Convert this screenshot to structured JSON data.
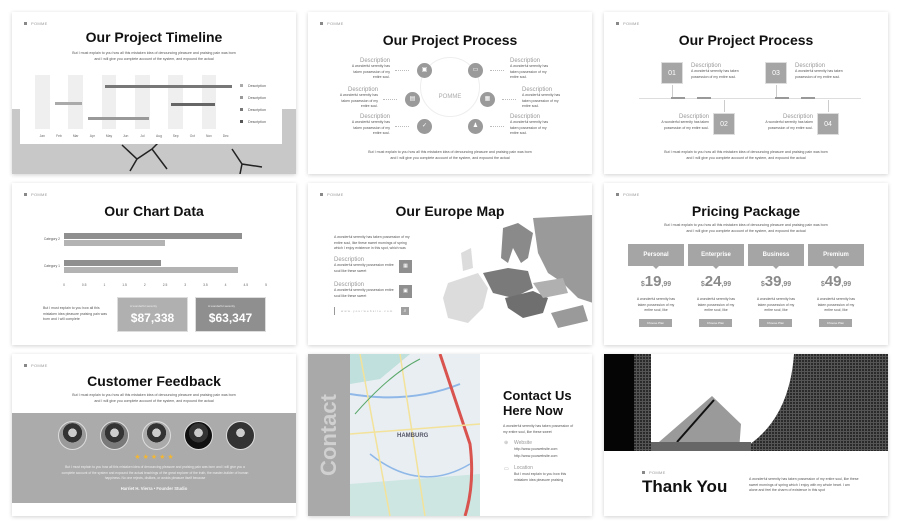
{
  "brand": "POMME",
  "body_text": "But I must explain to you how all this mistaken idea of denouncing pleasure and praising pain was born and I will give you complete account of the system, and expound the actual",
  "short_desc": "A wonderful serenity has taken possession of my entire soul.",
  "timeline": {
    "title": "Our Project Timeline",
    "months": [
      "Jan",
      "Feb",
      "Mar",
      "Apr",
      "May",
      "Jun",
      "Jul",
      "Aug",
      "Sep",
      "Oct",
      "Nov",
      "Dec"
    ],
    "bars": [
      {
        "start": "Feb",
        "end": "Mar",
        "color": "#aaaaaa"
      },
      {
        "start": "Apr",
        "end": "Jul",
        "color": "#999999"
      },
      {
        "start": "May",
        "end": "Dec",
        "color": "#777777"
      },
      {
        "start": "Sep",
        "end": "Nov",
        "color": "#666666"
      }
    ],
    "legend": [
      "Description",
      "Description",
      "Description",
      "Description"
    ],
    "legend_colors": [
      "#aaaaaa",
      "#999999",
      "#777777",
      "#555555"
    ]
  },
  "process": {
    "title": "Our Project Process",
    "center": "POMME",
    "items": [
      {
        "heading": "Description",
        "text": "A wonderful serenity has taken possession of my entire soul."
      },
      {
        "heading": "Description",
        "text": "A wonderful serenity has taken possession of my entire soul."
      },
      {
        "heading": "Description",
        "text": "A wonderful serenity has taken possession of my entire soul."
      },
      {
        "heading": "Description",
        "text": "A wonderful serenity has taken possession of my entire soul."
      },
      {
        "heading": "Description",
        "text": "A wonderful serenity has taken possession of my entire soul."
      },
      {
        "heading": "Description",
        "text": "A wonderful serenity has taken possession of my entire soul."
      }
    ],
    "icons": [
      "briefcase-icon",
      "laptop-icon",
      "document-icon",
      "chart-icon",
      "handshake-icon",
      "people-icon"
    ]
  },
  "steps": {
    "title": "Our Project Process",
    "items": [
      {
        "num": "01",
        "heading": "Description",
        "text": "A wonderful serenity has taken possession of my entire soul."
      },
      {
        "num": "02",
        "heading": "Description",
        "text": "A wonderful serenity has taken possession of my entire soul."
      },
      {
        "num": "03",
        "heading": "Description",
        "text": "A wonderful serenity has taken possession of my entire soul."
      },
      {
        "num": "04",
        "heading": "Description",
        "text": "A wonderful serenity has taken possession of my entire soul."
      }
    ]
  },
  "chart_slide": {
    "title": "Our Chart Data",
    "note": "But I must explain to you how all this mistaken idea pleasure praising pain was born and I will complete",
    "stats": [
      {
        "label": "A wonderful serenity",
        "value": "$87,338",
        "color": "#b0b0b0"
      },
      {
        "label": "A wonderful serenity",
        "value": "$63,347",
        "color": "#8f8f8f"
      }
    ]
  },
  "chart_data": {
    "type": "bar",
    "orientation": "horizontal",
    "categories": [
      "Category 2",
      "Category 1"
    ],
    "series": [
      {
        "values": [
          4.4,
          2.4
        ],
        "color": "#8f8f8f"
      },
      {
        "values": [
          2.5,
          4.3
        ],
        "color": "#b3b3b3"
      }
    ],
    "xlim": [
      0,
      5
    ],
    "ticks": [
      "0",
      "0.5",
      "1",
      "1.5",
      "2",
      "2.5",
      "3",
      "3.5",
      "4",
      "4.5",
      "5"
    ],
    "grid": false
  },
  "europe": {
    "title": "Our Europe Map",
    "intro": "A wonderful serenity has taken possession of my entire soul, like these sweet mornings of spring which I enjoy existence in this spot, which was",
    "items": [
      {
        "heading": "Description",
        "text": "A wonderful serenity possession entire soul like these sweet",
        "icon": "calendar-icon"
      },
      {
        "heading": "Description",
        "text": "A wonderful serenity possession entire soul like these sweet",
        "icon": "briefcase-icon"
      }
    ],
    "website": "www.yourwebsite.com"
  },
  "pricing": {
    "title": "Pricing Package",
    "plans": [
      {
        "name": "Personal",
        "currency": "$",
        "amount": "19",
        "cents": ",99",
        "text": "A wonderful serenity has taken possession of my entire soul, like",
        "button": "Choose Plan"
      },
      {
        "name": "Enterprise",
        "currency": "$",
        "amount": "24",
        "cents": ",99",
        "text": "A wonderful serenity has taken possession of my entire soul, like",
        "button": "Choose Plan"
      },
      {
        "name": "Business",
        "currency": "$",
        "amount": "39",
        "cents": ",99",
        "text": "A wonderful serenity has taken possession of my entire soul, like",
        "button": "Choose Plan"
      },
      {
        "name": "Premium",
        "currency": "$",
        "amount": "49",
        "cents": ",99",
        "text": "A wonderful serenity has taken possession of my entire soul, like",
        "button": "Choose Plan"
      }
    ]
  },
  "feedback": {
    "title": "Customer Feedback",
    "rating": 5,
    "star_color": "#f2b632",
    "quote": "But I must explain to you how all this mistaken idea of denouncing pleasure and praising pain was born and I will give you a complete account of the system and expound the actual teachings of the great explorer of the truth, the master-builder of human happiness. No one rejects, dislikes, or avoids pleasure itself because",
    "author": "Harriet H. Vierra • Founder Studio"
  },
  "contact": {
    "side_label": "Contact",
    "title_line1": "Contact Us",
    "title_line2": "Here Now",
    "intro": "A wonderful serenity has taken possession of my entire soul, like these sweet",
    "map_label": "HAMBURG",
    "website_heading": "Website",
    "websites": [
      "http://www.yourwebsite.com",
      "http://www.yourwebsite.com"
    ],
    "location_heading": "Location",
    "location_text": "But I must explain to you how this mistaken idea pleasure praising"
  },
  "thanks": {
    "title": "Thank You",
    "text": "A wonderful serenity has taken possession of my entire soul, like these sweet mornings of spring which I enjoy with my whole heart. I am alone and feel the charm of existence in this spot"
  }
}
